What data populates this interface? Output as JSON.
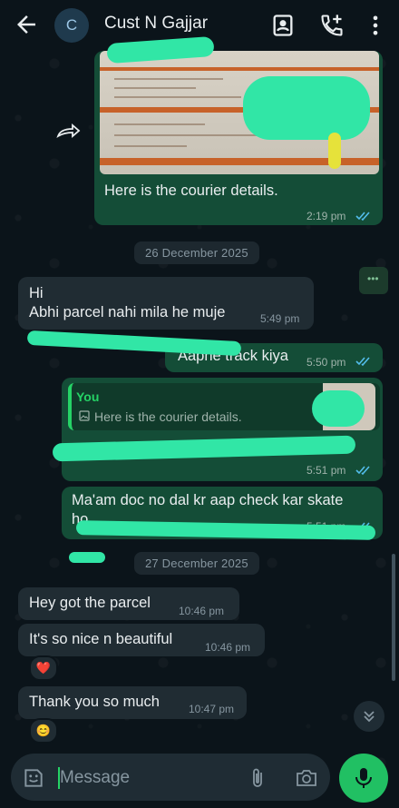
{
  "header": {
    "contact_initial": "C",
    "contact_name": "Cust N Gajjar"
  },
  "messages": [
    {
      "id": "m1",
      "type": "image",
      "direction": "out",
      "caption": "Here is the courier details.",
      "time": "2:19 pm",
      "status": "read"
    },
    {
      "id": "d1",
      "type": "date",
      "label": "26 December 2025"
    },
    {
      "id": "m2",
      "type": "text",
      "direction": "in",
      "lines": [
        "Hi",
        "Abhi parcel nahi mila he muje"
      ],
      "time": "5:49 pm"
    },
    {
      "id": "m3",
      "type": "text",
      "direction": "out",
      "text": "Aaphe track kiya",
      "time": "5:50 pm",
      "status": "read"
    },
    {
      "id": "m4",
      "type": "reply",
      "direction": "out",
      "quote_author": "You",
      "quote_text": "Here is the courier details.",
      "time": "5:51 pm",
      "status": "read"
    },
    {
      "id": "m5",
      "type": "text",
      "direction": "out",
      "text": "Ma'am doc no dal kr aap check kar skate ho",
      "time": "5:51 pm",
      "status": "read"
    },
    {
      "id": "d2",
      "type": "date",
      "label": "27 December 2025"
    },
    {
      "id": "m6",
      "type": "text",
      "direction": "in",
      "text": "Hey got the parcel",
      "time": "10:46 pm"
    },
    {
      "id": "m7",
      "type": "text",
      "direction": "in",
      "text": "It's so nice n beautiful",
      "time": "10:46 pm",
      "reaction": "❤️"
    },
    {
      "id": "m8",
      "type": "text",
      "direction": "in",
      "text": "Thank you so much",
      "time": "10:47 pm",
      "reaction": "😊"
    }
  ],
  "composer": {
    "placeholder": "Message"
  },
  "colors": {
    "background": "#0b141a",
    "out_bubble": "#144d37",
    "in_bubble": "#202c33",
    "accent": "#25d366",
    "mic": "#21c063",
    "read_ticks": "#53bdeb"
  }
}
